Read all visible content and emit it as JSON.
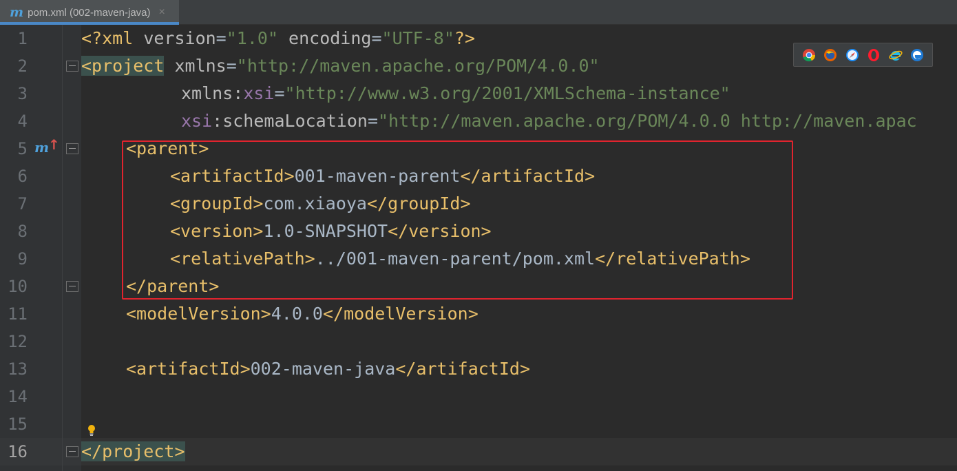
{
  "tab": {
    "icon": "m",
    "title": "pom.xml (002-maven-java)",
    "close": "×"
  },
  "editor": {
    "current_line": 16,
    "lines": [
      {
        "n": "1"
      },
      {
        "n": "2"
      },
      {
        "n": "3"
      },
      {
        "n": "4"
      },
      {
        "n": "5"
      },
      {
        "n": "6"
      },
      {
        "n": "7"
      },
      {
        "n": "8"
      },
      {
        "n": "9"
      },
      {
        "n": "10"
      },
      {
        "n": "11"
      },
      {
        "n": "12"
      },
      {
        "n": "13"
      },
      {
        "n": "14"
      },
      {
        "n": "15"
      },
      {
        "n": "16"
      }
    ],
    "tokens": {
      "l1_open": "<?xml ",
      "l1_attr1": "version",
      "l1_eq1": "=",
      "l1_val1": "\"1.0\"",
      "l1_attr2": " encoding",
      "l1_eq2": "=",
      "l1_val2": "\"UTF-8\"",
      "l1_close": "?>",
      "l2_tag": "<project",
      "l2_attr": " xmlns",
      "l2_eq": "=",
      "l2_val": "\"http://maven.apache.org/POM/4.0.0\"",
      "l3_attr": "xmlns:",
      "l3_ns": "xsi",
      "l3_eq": "=",
      "l3_val": "\"http://www.w3.org/2001/XMLSchema-instance\"",
      "l4_ns": "xsi",
      "l4_attr": ":schemaLocation",
      "l4_eq": "=",
      "l4_val": "\"http://maven.apache.org/POM/4.0.0 http://maven.apac",
      "l5": "<parent>",
      "l6_open": "<artifactId>",
      "l6_text": "001-maven-parent",
      "l6_close": "</artifactId>",
      "l7_open": "<groupId>",
      "l7_text": "com.xiaoya",
      "l7_close": "</groupId>",
      "l8_open": "<version>",
      "l8_text": "1.0-SNAPSHOT",
      "l8_close": "</version>",
      "l9_open": "<relativePath>",
      "l9_text": "../001-maven-parent/pom.xml",
      "l9_close": "</relativePath>",
      "l10": "</parent>",
      "l11_open": "<modelVersion>",
      "l11_text": "4.0.0",
      "l11_close": "</modelVersion>",
      "l13_open": "<artifactId>",
      "l13_text": "002-maven-java",
      "l13_close": "</artifactId>",
      "l16": "</project>"
    },
    "gutter_marker": {
      "icon": "m",
      "arrow": "↑"
    }
  },
  "browsers": [
    {
      "name": "chrome-icon"
    },
    {
      "name": "firefox-icon"
    },
    {
      "name": "safari-icon"
    },
    {
      "name": "opera-icon"
    },
    {
      "name": "ie-icon"
    },
    {
      "name": "edge-icon"
    }
  ],
  "colors": {
    "tag": "#e8bf6a",
    "attribute": "#bababa",
    "namespace": "#9876aa",
    "string": "#6a8759",
    "text": "#a9b7c6",
    "highlight_box": "#e0242e",
    "tab_underline": "#4a88c7"
  }
}
